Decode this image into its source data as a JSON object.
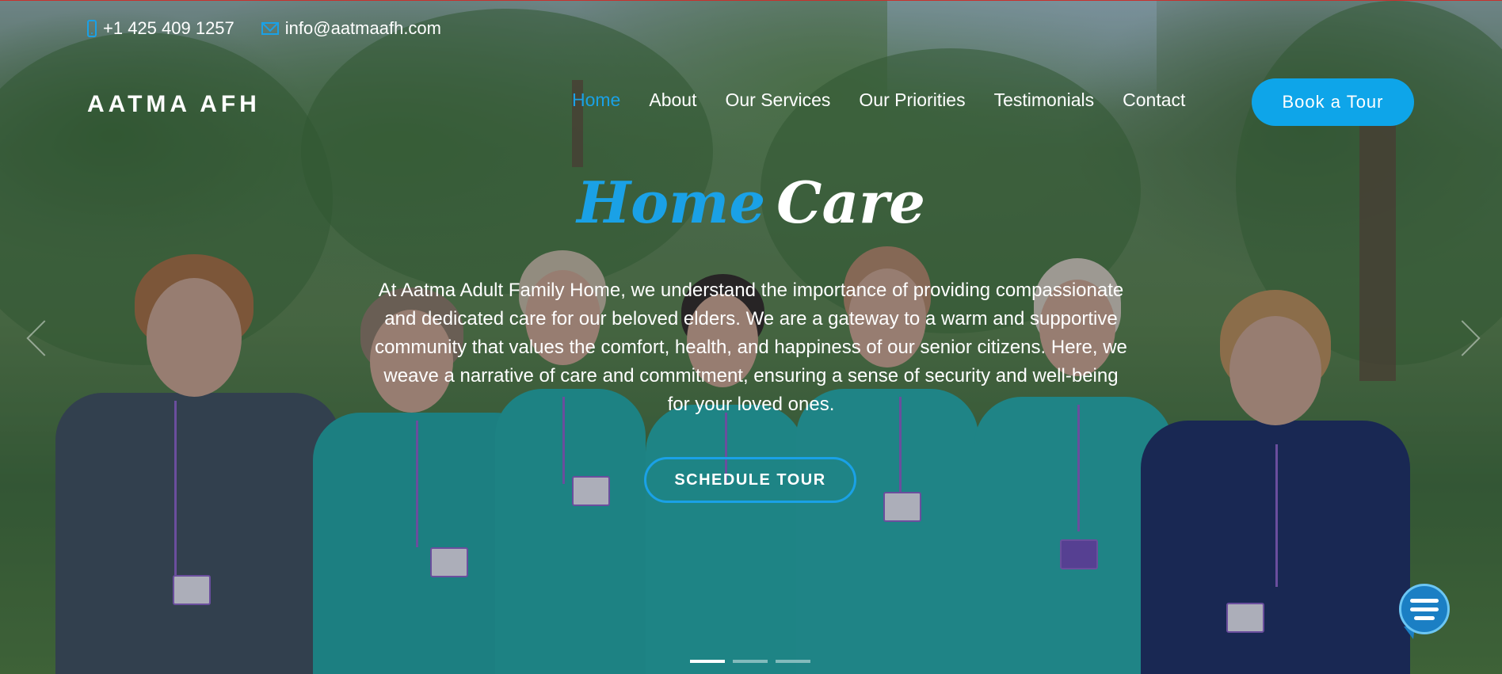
{
  "topbar": {
    "phone": "+1 425 409 1257",
    "email": "info@aatmaafh.com"
  },
  "brand": "AATMA AFH",
  "nav": {
    "items": [
      {
        "label": "Home",
        "active": true
      },
      {
        "label": "About"
      },
      {
        "label": "Our Services"
      },
      {
        "label": "Our Priorities"
      },
      {
        "label": "Testimonials"
      },
      {
        "label": "Contact"
      }
    ],
    "cta_label": "Book a Tour"
  },
  "hero": {
    "headline_word1": "Home",
    "headline_word2": "Care",
    "intro": "At Aatma Adult Family Home, we understand the importance of providing compassionate and dedicated care for our beloved elders. We are a gateway to a warm and supportive community that values the comfort, health, and happiness of our senior citizens. Here, we weave a narrative of care and commitment, ensuring a sense of security and well-being for your loved ones.",
    "cta_label": "SCHEDULE TOUR",
    "slides_total": 3,
    "active_slide": 1
  },
  "icons": {
    "phone": "phone-icon",
    "email": "envelope-icon",
    "chat": "chat-bubble-icon",
    "prev": "chevron-left-icon",
    "next": "chevron-right-icon"
  },
  "colors": {
    "accent": "#1aa1e6",
    "cta": "#0ea5e9",
    "text": "#ffffff",
    "chat": "#1b7fc4"
  }
}
